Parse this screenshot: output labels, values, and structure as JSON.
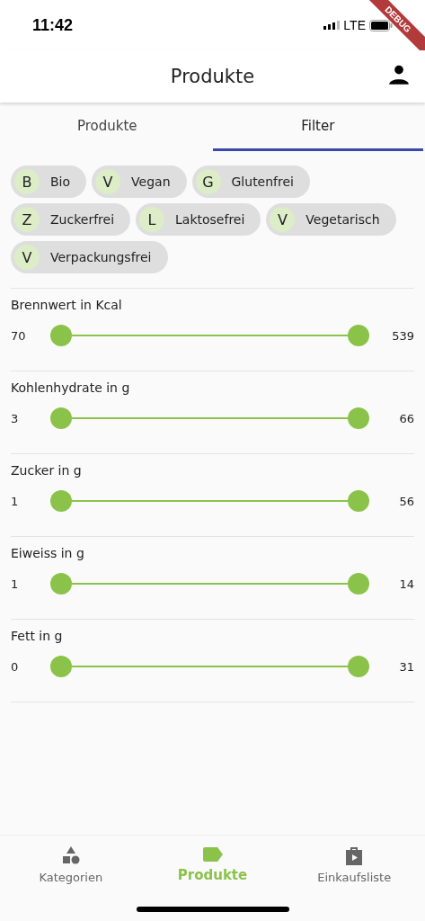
{
  "status_bar": {
    "time": "11:42",
    "network": "LTE"
  },
  "debug_banner": {
    "label": "DEBUG"
  },
  "app_bar": {
    "title": "Produkte"
  },
  "tabs": [
    {
      "label": "Produkte",
      "selected": false
    },
    {
      "label": "Filter",
      "selected": true
    }
  ],
  "chips": [
    {
      "avatar": "B",
      "label": "Bio"
    },
    {
      "avatar": "V",
      "label": "Vegan"
    },
    {
      "avatar": "G",
      "label": "Glutenfrei"
    },
    {
      "avatar": "Z",
      "label": "Zuckerfrei"
    },
    {
      "avatar": "L",
      "label": "Laktosefrei"
    },
    {
      "avatar": "V",
      "label": "Vegetarisch"
    },
    {
      "avatar": "V",
      "label": "Verpackungsfrei"
    }
  ],
  "range_filters": [
    {
      "label": "Brennwert in Kcal",
      "min": "70",
      "max": "539"
    },
    {
      "label": "Kohlenhydrate in g",
      "min": "3",
      "max": "66"
    },
    {
      "label": "Zucker in g",
      "min": "1",
      "max": "56"
    },
    {
      "label": "Eiweiss in g",
      "min": "1",
      "max": "14"
    },
    {
      "label": "Fett in g",
      "min": "0",
      "max": "31"
    }
  ],
  "bottom_nav": [
    {
      "label": "Kategorien",
      "selected": false
    },
    {
      "label": "Produkte",
      "selected": true
    },
    {
      "label": "Einkaufsliste",
      "selected": false
    }
  ]
}
